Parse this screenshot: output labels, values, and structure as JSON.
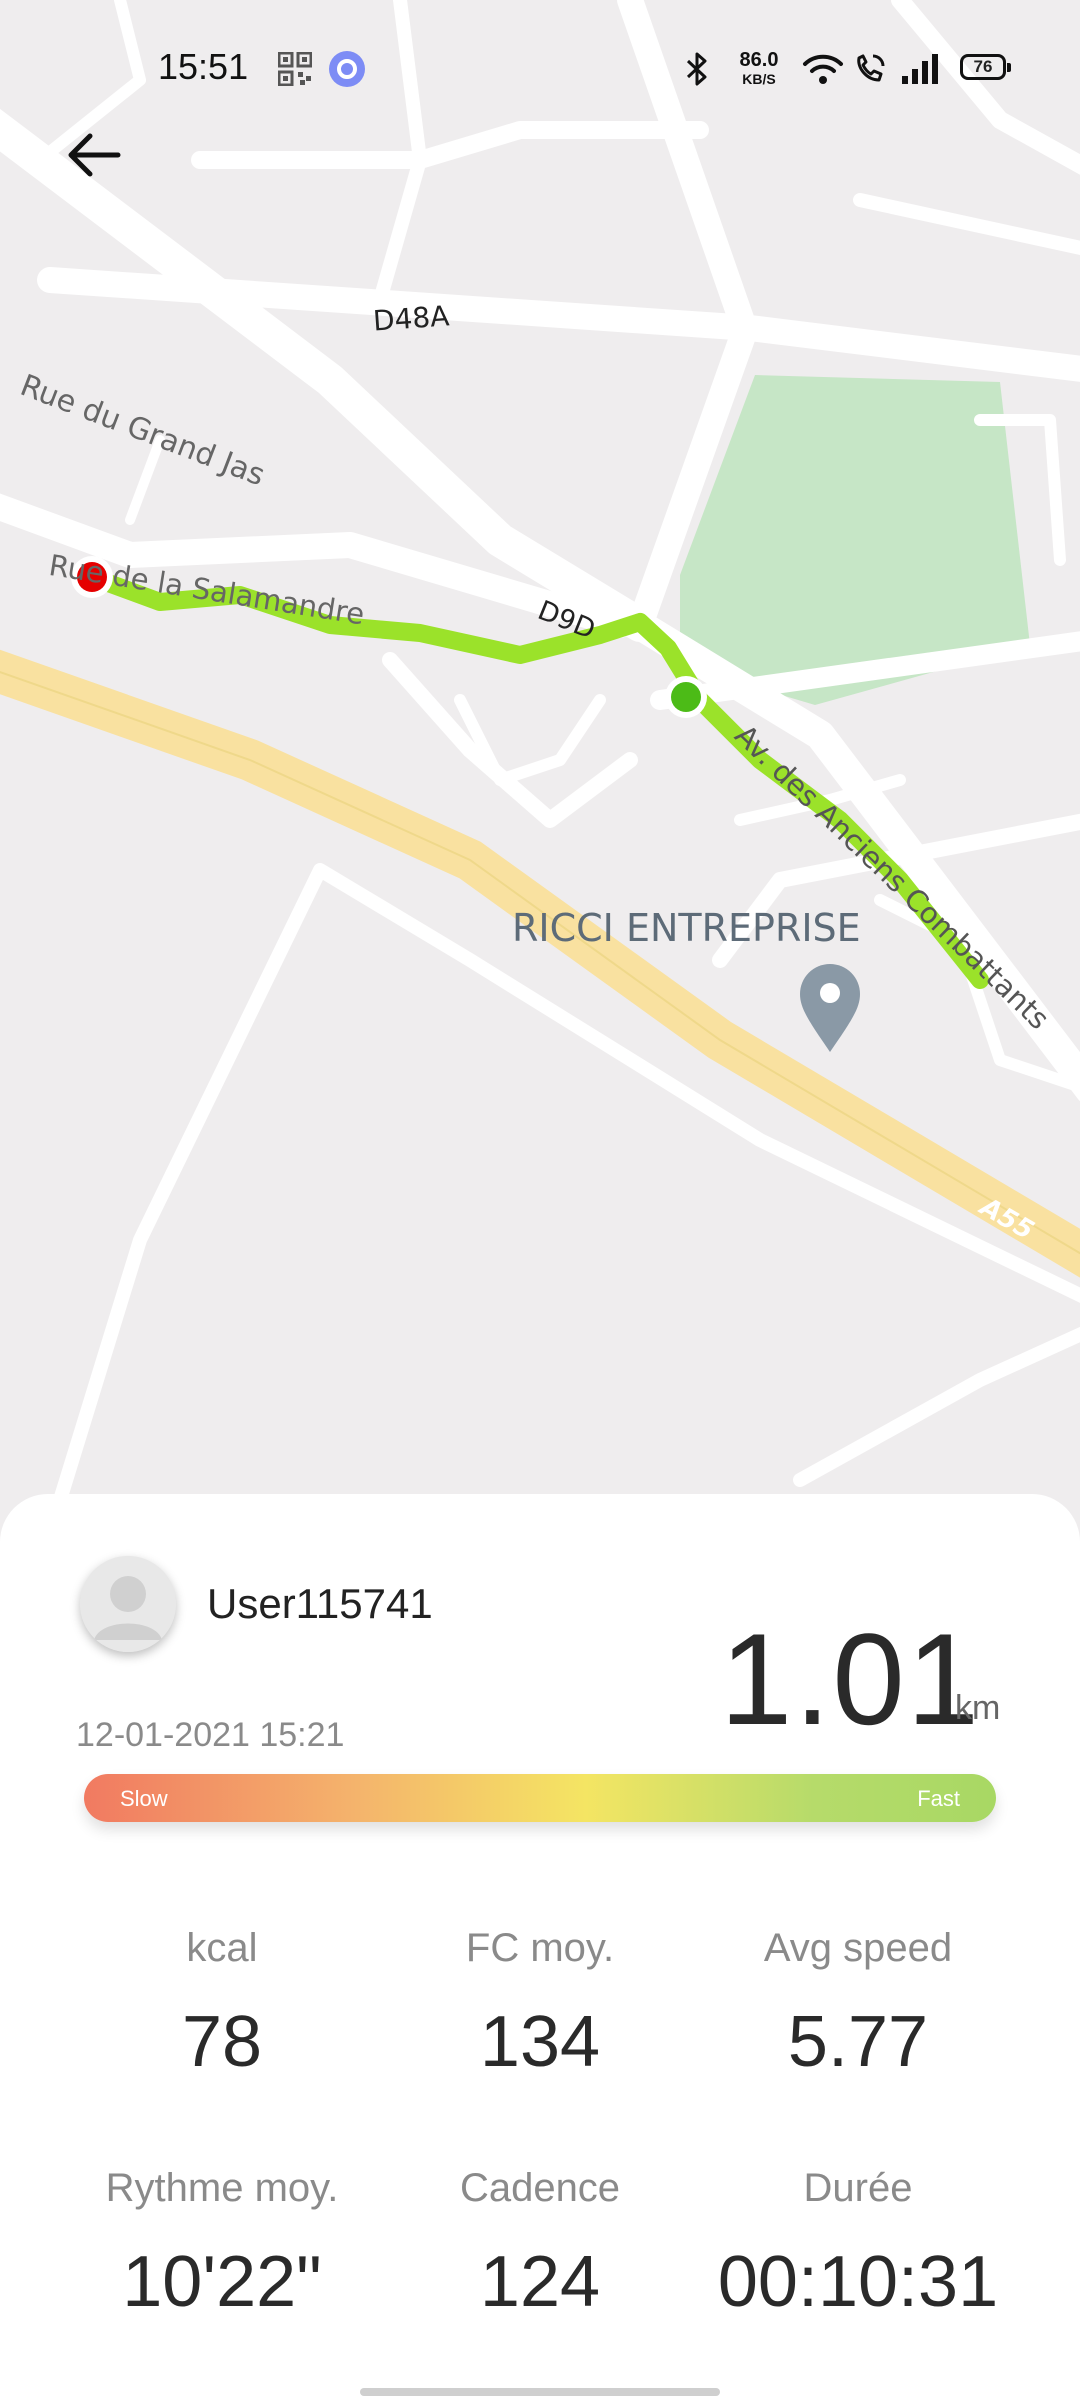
{
  "status_bar": {
    "time": "15:51",
    "net_speed_value": "86.0",
    "net_speed_unit": "KB/S",
    "battery": "76"
  },
  "map": {
    "labels": {
      "d48a": "D48A",
      "rue_grand_jas": "Rue du Grand Jas",
      "rue_salamandre": "Rue de la Salamandre",
      "d9d": "D9D",
      "av_anciens_combattants": "Av. des Anciens Combattants",
      "ricci": "RICCI ENTREPRISE",
      "a55": "A55"
    },
    "colors": {
      "route": "#9be22a",
      "start_marker": "#e50000",
      "end_marker": "#4cbb17",
      "park": "#c6e6c6",
      "highway": "#f9e1a0",
      "poi_pin": "#8a99a6"
    }
  },
  "summary": {
    "username": "User115741",
    "date": "12-01-2021 15:21",
    "distance": "1.01",
    "distance_unit": "km",
    "pace_bar": {
      "slow": "Slow",
      "fast": "Fast"
    }
  },
  "stats": [
    {
      "label": "kcal",
      "value": "78"
    },
    {
      "label": "FC moy.",
      "value": "134"
    },
    {
      "label": "Avg speed",
      "value": "5.77"
    },
    {
      "label": "Rythme moy.",
      "value": "10'22\""
    },
    {
      "label": "Cadence",
      "value": "124"
    },
    {
      "label": "Durée",
      "value": "00:10:31"
    }
  ]
}
